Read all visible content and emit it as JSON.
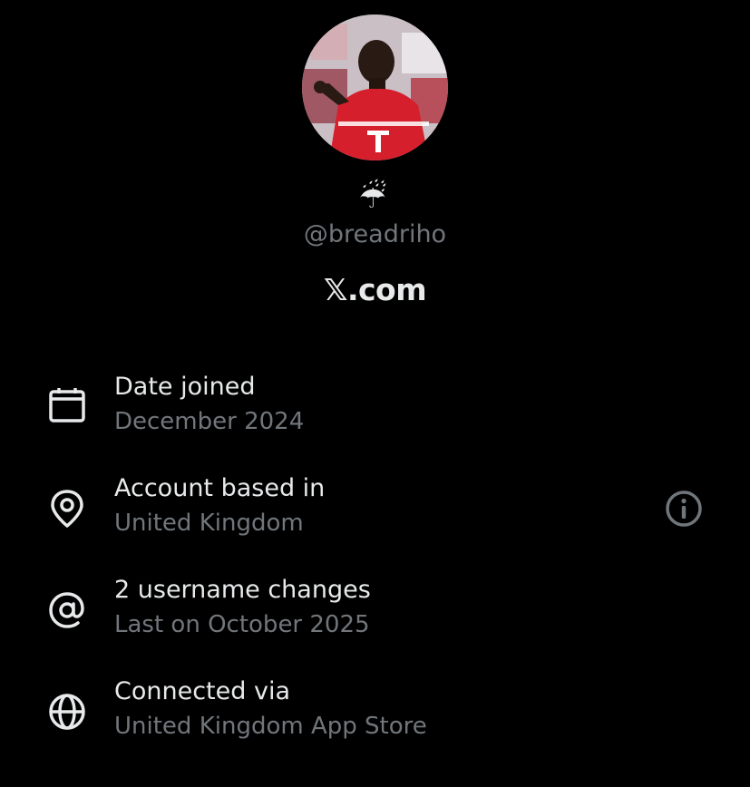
{
  "profile": {
    "avatar_icon": "profile-photo",
    "emoji": "☔",
    "handle": "@breadriho",
    "brand": "𝕏.com"
  },
  "details": [
    {
      "icon": "calendar-icon",
      "title": "Date joined",
      "subtitle": "December 2024"
    },
    {
      "icon": "location-pin-icon",
      "title": "Account based in",
      "subtitle": "United Kingdom",
      "has_info": true,
      "info_icon": "info-icon"
    },
    {
      "icon": "at-sign-icon",
      "title": "2 username changes",
      "subtitle": "Last on October 2025"
    },
    {
      "icon": "globe-icon",
      "title": "Connected via",
      "subtitle": "United Kingdom App Store"
    }
  ],
  "colors": {
    "background": "#000000",
    "primary_text": "#e7e9ea",
    "secondary_text": "#71767b",
    "jersey_red": "#d61f2c"
  }
}
